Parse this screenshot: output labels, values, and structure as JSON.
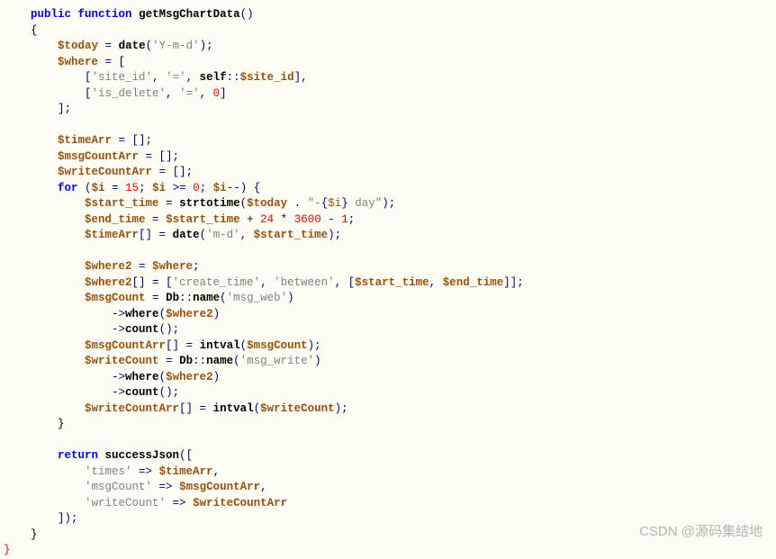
{
  "code": {
    "line1_public": "public",
    "line1_function": "function",
    "line1_name": "getMsgChartData",
    "line3_var": "$today",
    "line3_fn": "date",
    "line3_arg": "'Y-m-d'",
    "line4_var": "$where",
    "line5_a": "'site_id'",
    "line5_b": "'='",
    "line5_self": "self",
    "line5_siteid": "$site_id",
    "line6_a": "'is_delete'",
    "line6_b": "'='",
    "line6_c": "0",
    "line8_var": "$timeArr",
    "line9_var": "$msgCountArr",
    "line10_var": "$writeCountArr",
    "line11_for": "for",
    "line11_i": "$i",
    "line11_15": "15",
    "line11_0": "0",
    "line12_var": "$start_time",
    "line12_fn": "strtotime",
    "line12_today": "$today",
    "line12_str1": "\"-",
    "line12_i": "$i",
    "line12_str2": " day\"",
    "line13_var": "$end_time",
    "line13_st": "$start_time",
    "line13_24": "24",
    "line13_3600": "3600",
    "line13_1": "1",
    "line14_var": "$timeArr",
    "line14_fn": "date",
    "line14_arg": "'m-d'",
    "line14_st": "$start_time",
    "line16_var": "$where2",
    "line16_where": "$where",
    "line17_var": "$where2",
    "line17_a": "'create_time'",
    "line17_b": "'between'",
    "line17_st": "$start_time",
    "line17_et": "$end_time",
    "line18_var": "$msgCount",
    "line18_db": "Db",
    "line18_name": "name",
    "line18_arg": "'msg_web'",
    "line19_where": "where",
    "line19_arg": "$where2",
    "line20_count": "count",
    "line21_var": "$msgCountArr",
    "line21_fn": "intval",
    "line21_arg": "$msgCount",
    "line22_var": "$writeCount",
    "line22_db": "Db",
    "line22_name": "name",
    "line22_arg": "'msg_write'",
    "line23_where": "where",
    "line23_arg": "$where2",
    "line24_count": "count",
    "line25_var": "$writeCountArr",
    "line25_fn": "intval",
    "line25_arg": "$writeCount",
    "line27_return": "return",
    "line27_fn": "successJson",
    "line28_key": "'times'",
    "line28_val": "$timeArr",
    "line29_key": "'msgCount'",
    "line29_val": "$msgCountArr",
    "line30_key": "'writeCount'",
    "line30_val": "$writeCountArr"
  },
  "watermark": "CSDN @源码集结地"
}
